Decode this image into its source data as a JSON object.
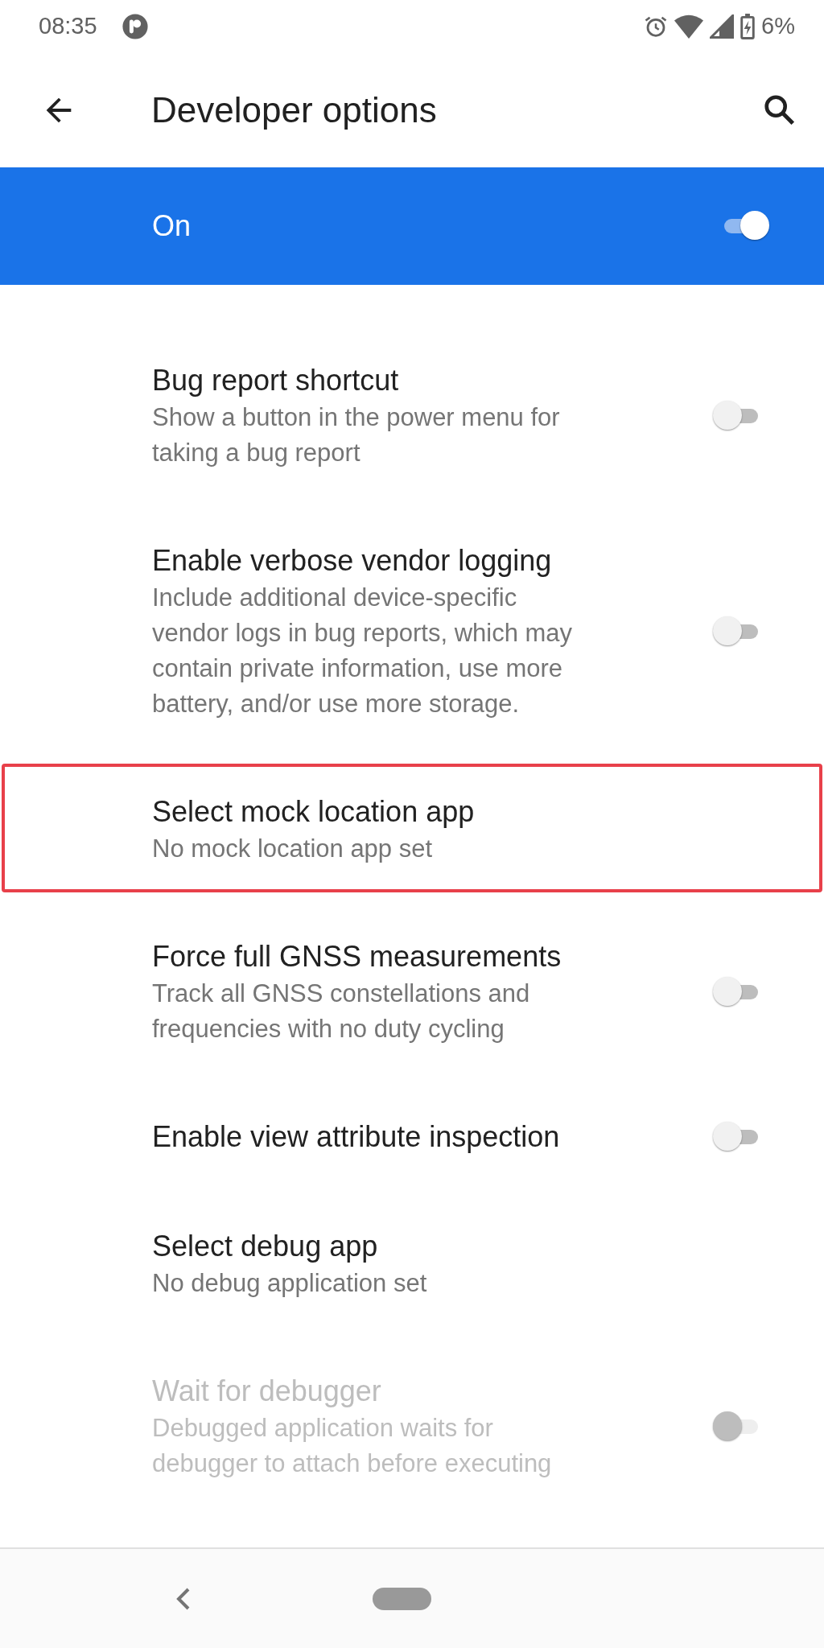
{
  "status_bar": {
    "time": "08:35",
    "battery": "6%"
  },
  "toolbar": {
    "title": "Developer options"
  },
  "master_switch": {
    "label": "On",
    "on": true
  },
  "settings": [
    {
      "kind": "switch",
      "title": "Bug report shortcut",
      "summary_lines": [
        "Show a button in the power menu for",
        "taking a bug report"
      ],
      "on": false,
      "disabled": false,
      "highlighted": false
    },
    {
      "kind": "switch",
      "title": "Enable verbose vendor logging",
      "summary_lines": [
        "Include additional device-specific",
        "vendor logs in bug reports, which may",
        "contain private information, use more",
        "battery, and/or use more storage."
      ],
      "on": false,
      "disabled": false,
      "highlighted": false
    },
    {
      "kind": "link",
      "title": "Select mock location app",
      "summary_lines": [
        "No mock location app set"
      ],
      "disabled": false,
      "highlighted": true
    },
    {
      "kind": "switch",
      "title": "Force full GNSS measurements",
      "summary_lines": [
        "Track all GNSS constellations and",
        "frequencies with no duty cycling"
      ],
      "on": false,
      "disabled": false,
      "highlighted": false
    },
    {
      "kind": "switch",
      "title": "Enable view attribute inspection",
      "on": false,
      "disabled": false,
      "highlighted": false
    },
    {
      "kind": "link",
      "title": "Select debug app",
      "summary_lines": [
        "No debug application set"
      ],
      "disabled": false,
      "highlighted": false
    },
    {
      "kind": "switch",
      "title": "Wait for debugger",
      "summary_lines": [
        "Debugged application waits for",
        "debugger to attach before executing"
      ],
      "on": false,
      "disabled": true,
      "highlighted": false
    }
  ]
}
